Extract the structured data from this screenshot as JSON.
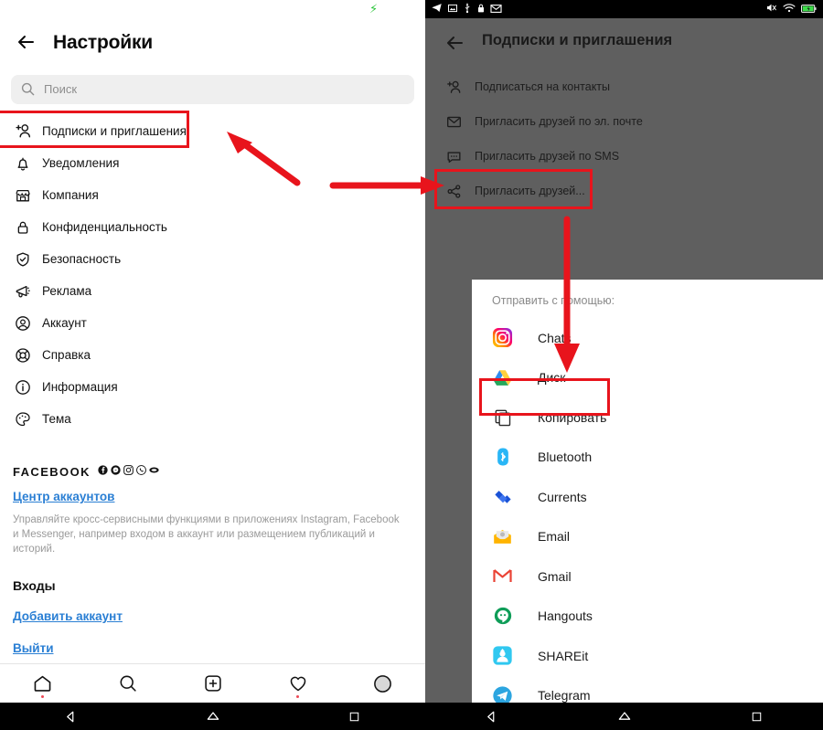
{
  "left_phone": {
    "statusbar": {
      "icons": [
        "bolt-icon"
      ]
    },
    "header": {
      "back_icon": "back-arrow-icon",
      "title": "Настройки"
    },
    "search": {
      "icon": "search-icon",
      "placeholder": "Поиск",
      "value": ""
    },
    "menu_items": [
      {
        "icon": "follow-person-icon",
        "label": "Подписки и приглашения",
        "highlighted": true
      },
      {
        "icon": "bell-icon",
        "label": "Уведомления"
      },
      {
        "icon": "store-icon",
        "label": "Компания"
      },
      {
        "icon": "lock-icon",
        "label": "Конфиденциальность"
      },
      {
        "icon": "shield-check-icon",
        "label": "Безопасность"
      },
      {
        "icon": "megaphone-icon",
        "label": "Реклама"
      },
      {
        "icon": "account-circle-icon",
        "label": "Аккаунт"
      },
      {
        "icon": "lifebuoy-icon",
        "label": "Справка"
      },
      {
        "icon": "info-circle-icon",
        "label": "Информация"
      },
      {
        "icon": "palette-icon",
        "label": "Тема"
      }
    ],
    "facebook_section": {
      "title": "FACEBOOK",
      "brand_icons": [
        "facebook-icon",
        "messenger-icon",
        "instagram-icon",
        "whatsapp-icon",
        "oculus-icon"
      ],
      "link": "Центр аккаунтов",
      "description": "Управляйте кросс-сервисными функциями в приложениях Instagram, Facebook и Messenger, например входом в аккаунт или размещением публикаций и историй."
    },
    "logins_section": {
      "title": "Входы",
      "add_account": "Добавить аккаунт",
      "logout": "Выйти"
    },
    "tabbar": [
      {
        "icon": "home-icon",
        "badge": true
      },
      {
        "icon": "search-icon",
        "badge": false
      },
      {
        "icon": "plus-square-icon",
        "badge": false
      },
      {
        "icon": "heart-icon",
        "badge": true
      },
      {
        "icon": "avatar-icon",
        "badge": false
      }
    ],
    "navbar": [
      {
        "icon": "android-back-icon"
      },
      {
        "icon": "android-home-icon"
      },
      {
        "icon": "android-recents-icon"
      }
    ]
  },
  "right_phone": {
    "statusbar": {
      "left_icons": [
        "telegram-icon",
        "screenshot-icon",
        "usb-icon",
        "lock-icon",
        "mail-icon"
      ],
      "right_icons": [
        "mute-icon",
        "wifi-icon",
        "battery-icon"
      ]
    },
    "header": {
      "back_icon": "back-arrow-icon",
      "title": "Подписки и приглашения"
    },
    "menu_items": [
      {
        "icon": "follow-person-icon",
        "label": "Подписаться на контакты",
        "highlighted": false
      },
      {
        "icon": "envelope-icon",
        "label": "Пригласить друзей по эл. почте",
        "highlighted": false
      },
      {
        "icon": "sms-bubble-icon",
        "label": "Пригласить друзей по SMS",
        "highlighted": false
      },
      {
        "icon": "share-nodes-icon",
        "label": "Пригласить друзей...",
        "highlighted": true
      }
    ],
    "share_sheet": {
      "heading": "Отправить с помощью:",
      "apps": [
        {
          "icon": "instagram-icon",
          "label": "Chats",
          "highlighted": false
        },
        {
          "icon": "google-drive-icon",
          "label": "Диск",
          "highlighted": false
        },
        {
          "icon": "copy-icon",
          "label": "Копировать",
          "highlighted": true
        },
        {
          "icon": "bluetooth-icon",
          "label": "Bluetooth",
          "highlighted": false
        },
        {
          "icon": "currents-icon",
          "label": "Currents",
          "highlighted": false
        },
        {
          "icon": "email-icon",
          "label": "Email",
          "highlighted": false
        },
        {
          "icon": "gmail-icon",
          "label": "Gmail",
          "highlighted": false
        },
        {
          "icon": "hangouts-icon",
          "label": "Hangouts",
          "highlighted": false
        },
        {
          "icon": "shareit-icon",
          "label": "SHAREit",
          "highlighted": false
        },
        {
          "icon": "telegram-icon",
          "label": "Telegram",
          "highlighted": false
        }
      ]
    },
    "navbar": [
      {
        "icon": "android-back-icon"
      },
      {
        "icon": "android-home-icon"
      },
      {
        "icon": "android-recents-icon"
      }
    ]
  },
  "annotations": {
    "highlight_color": "#e8141c",
    "arrows": [
      {
        "name": "arrow-to-subscriptions",
        "direction": "up-left"
      },
      {
        "name": "arrow-to-right-phone",
        "direction": "right"
      },
      {
        "name": "arrow-to-copy",
        "direction": "down"
      }
    ]
  }
}
